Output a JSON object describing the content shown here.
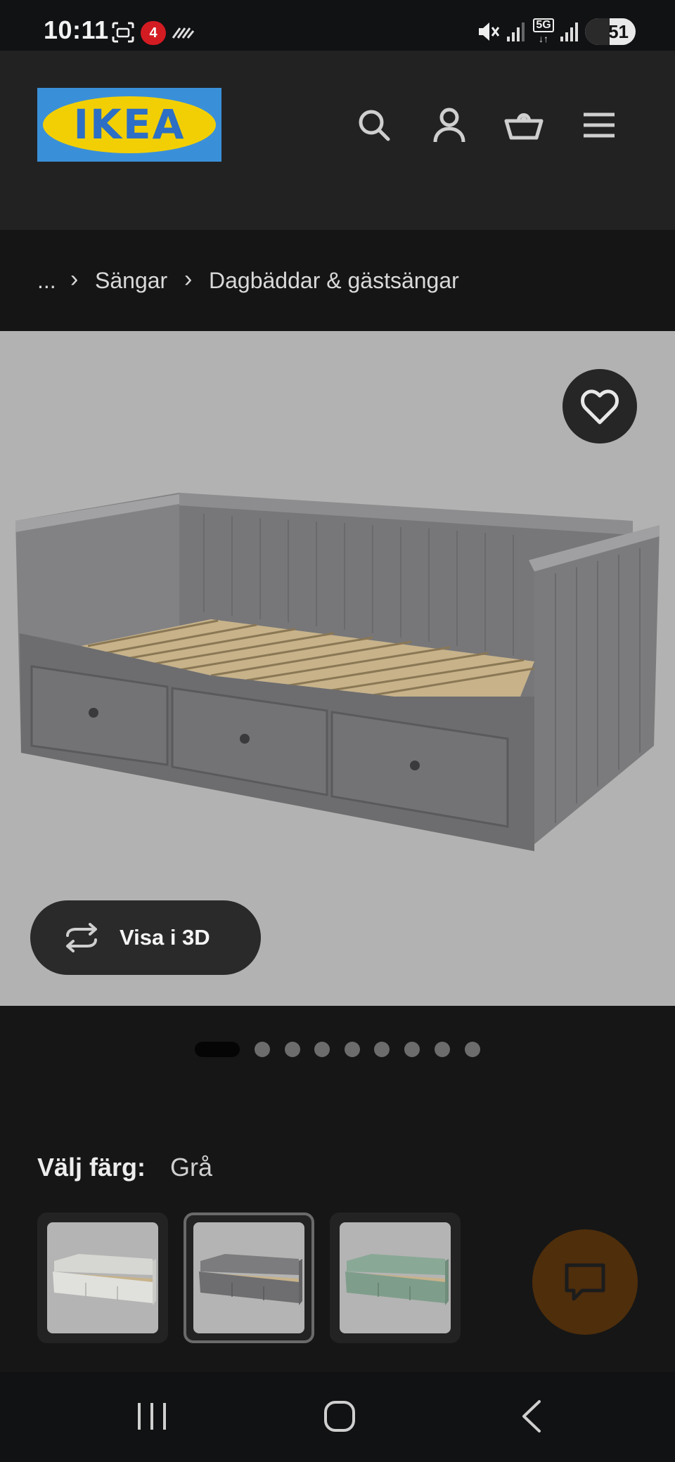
{
  "status_bar": {
    "time": "10:11",
    "badge": "4",
    "network": "5G",
    "battery": "51",
    "battery_level": 0.51,
    "icons": [
      "screenshot-icon",
      "tv4-play-icon",
      "signal-lines-icon",
      "mute-icon",
      "signal-icon",
      "5g-icon",
      "signal-icon",
      "battery-icon"
    ]
  },
  "header": {
    "logo_text": "IKEA",
    "icons": [
      "search-icon",
      "account-icon",
      "cart-icon",
      "menu-icon"
    ]
  },
  "breadcrumb": {
    "items": [
      "...",
      "Sängar",
      "Dagbäddar & gästsängar"
    ],
    "separator": "›"
  },
  "gallery": {
    "favorite_icon": "heart-icon",
    "view_3d_label": "Visa i 3D",
    "view_3d_icon": "rotate-3d-icon",
    "dot_count": 9,
    "active_index": 0
  },
  "color": {
    "label": "Välj färg:",
    "value": "Grå",
    "options": [
      {
        "name": "vit",
        "color": "#d6d6d2",
        "selected": false
      },
      {
        "name": "grå",
        "color": "#6e6e70",
        "selected": true
      },
      {
        "name": "grön",
        "color": "#7f9d8b",
        "selected": false
      }
    ]
  },
  "chat": {
    "icon": "chat-icon"
  },
  "colors": {
    "accent_logo_blue": "#3a90d8",
    "accent_logo_yellow": "#f2cf05",
    "chat_button": "#4f2e0b"
  }
}
